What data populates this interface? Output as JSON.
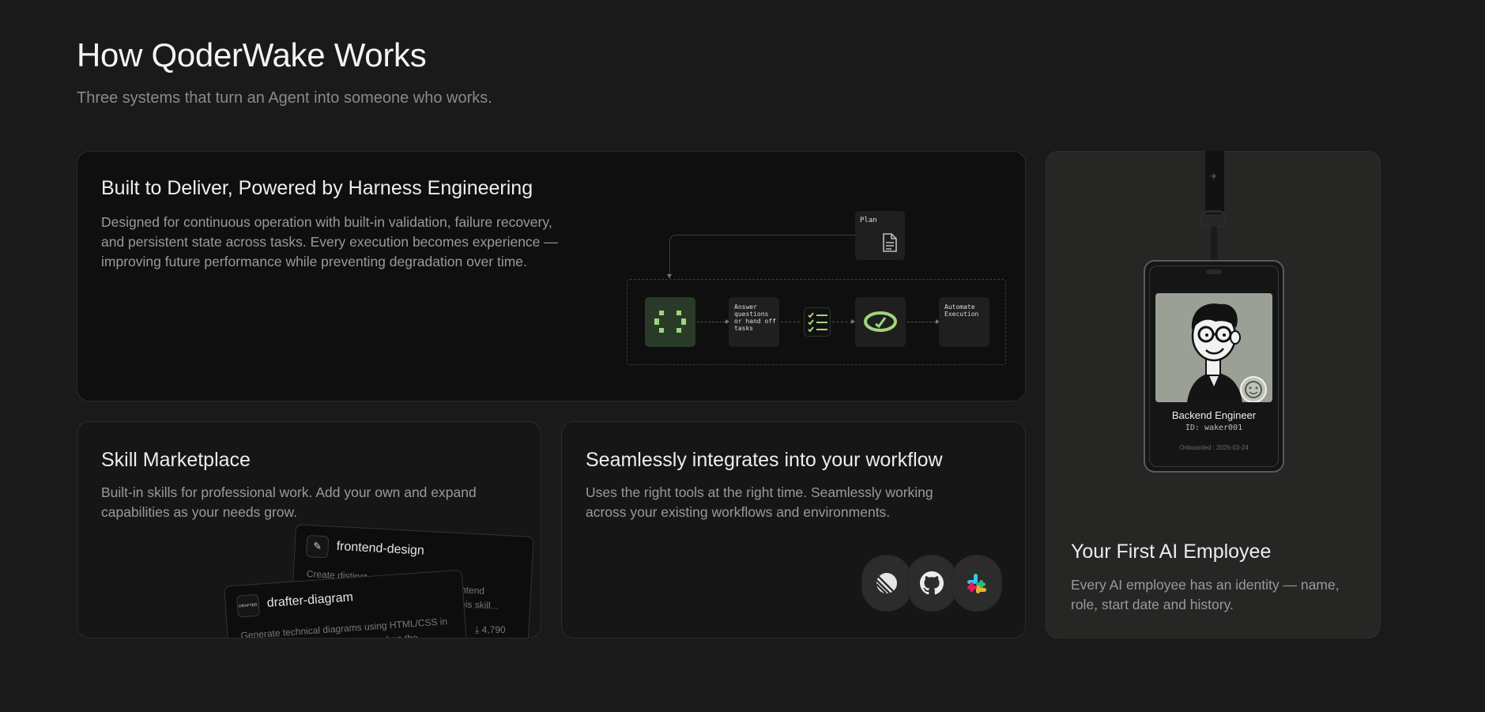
{
  "header": {
    "title": "How QoderWake Works",
    "subtitle": "Three systems that turn an Agent into someone who works."
  },
  "harness": {
    "title": "Built to Deliver, Powered by Harness Engineering",
    "description_lines": [
      "Designed for continuous operation with built-in validation, failure recovery,",
      "and persistent state across tasks. Every execution becomes experience —",
      "improving future performance while preventing degradation over time."
    ],
    "flow": {
      "plan_label": "Plan",
      "answer_label_lines": [
        "Answer",
        "questions",
        "or hand off",
        "tasks"
      ],
      "automate_label_lines": [
        "Automate",
        "Execution"
      ],
      "accent_color": "#9fd67c"
    }
  },
  "skill": {
    "title": "Skill Marketplace",
    "description_lines": [
      "Built-in skills for professional work. Add your own and expand",
      "capabilities as your needs grow."
    ],
    "cards": [
      {
        "name": "frontend-design",
        "icon": "design-tools-icon",
        "text": "Create distinct",
        "text_right_lines": [
          "ntend",
          "his skill..."
        ]
      },
      {
        "name": "drafter-diagram",
        "icon": "drafter-logo-icon",
        "icon_text": "DRAFTER",
        "text_lines": [
          "Generate technical diagrams using HTML/CSS in",
          "Use when the..."
        ],
        "downloads": "4,790"
      }
    ]
  },
  "integrations": {
    "title": "Seamlessly integrates into your workflow",
    "description_lines": [
      "Uses the right tools at the right time. Seamlessly working",
      "across your existing workflows and environments."
    ],
    "icons": [
      "linear-icon",
      "github-icon",
      "slack-icon"
    ]
  },
  "employee": {
    "title": "Your First AI Employee",
    "description_lines": [
      "Every AI employee has an identity — name,",
      "role, start date and history."
    ],
    "badge": {
      "role": "Backend Engineer",
      "id": "ID: waker001",
      "onboarded": "Onboarded : 2026-03-24"
    }
  }
}
